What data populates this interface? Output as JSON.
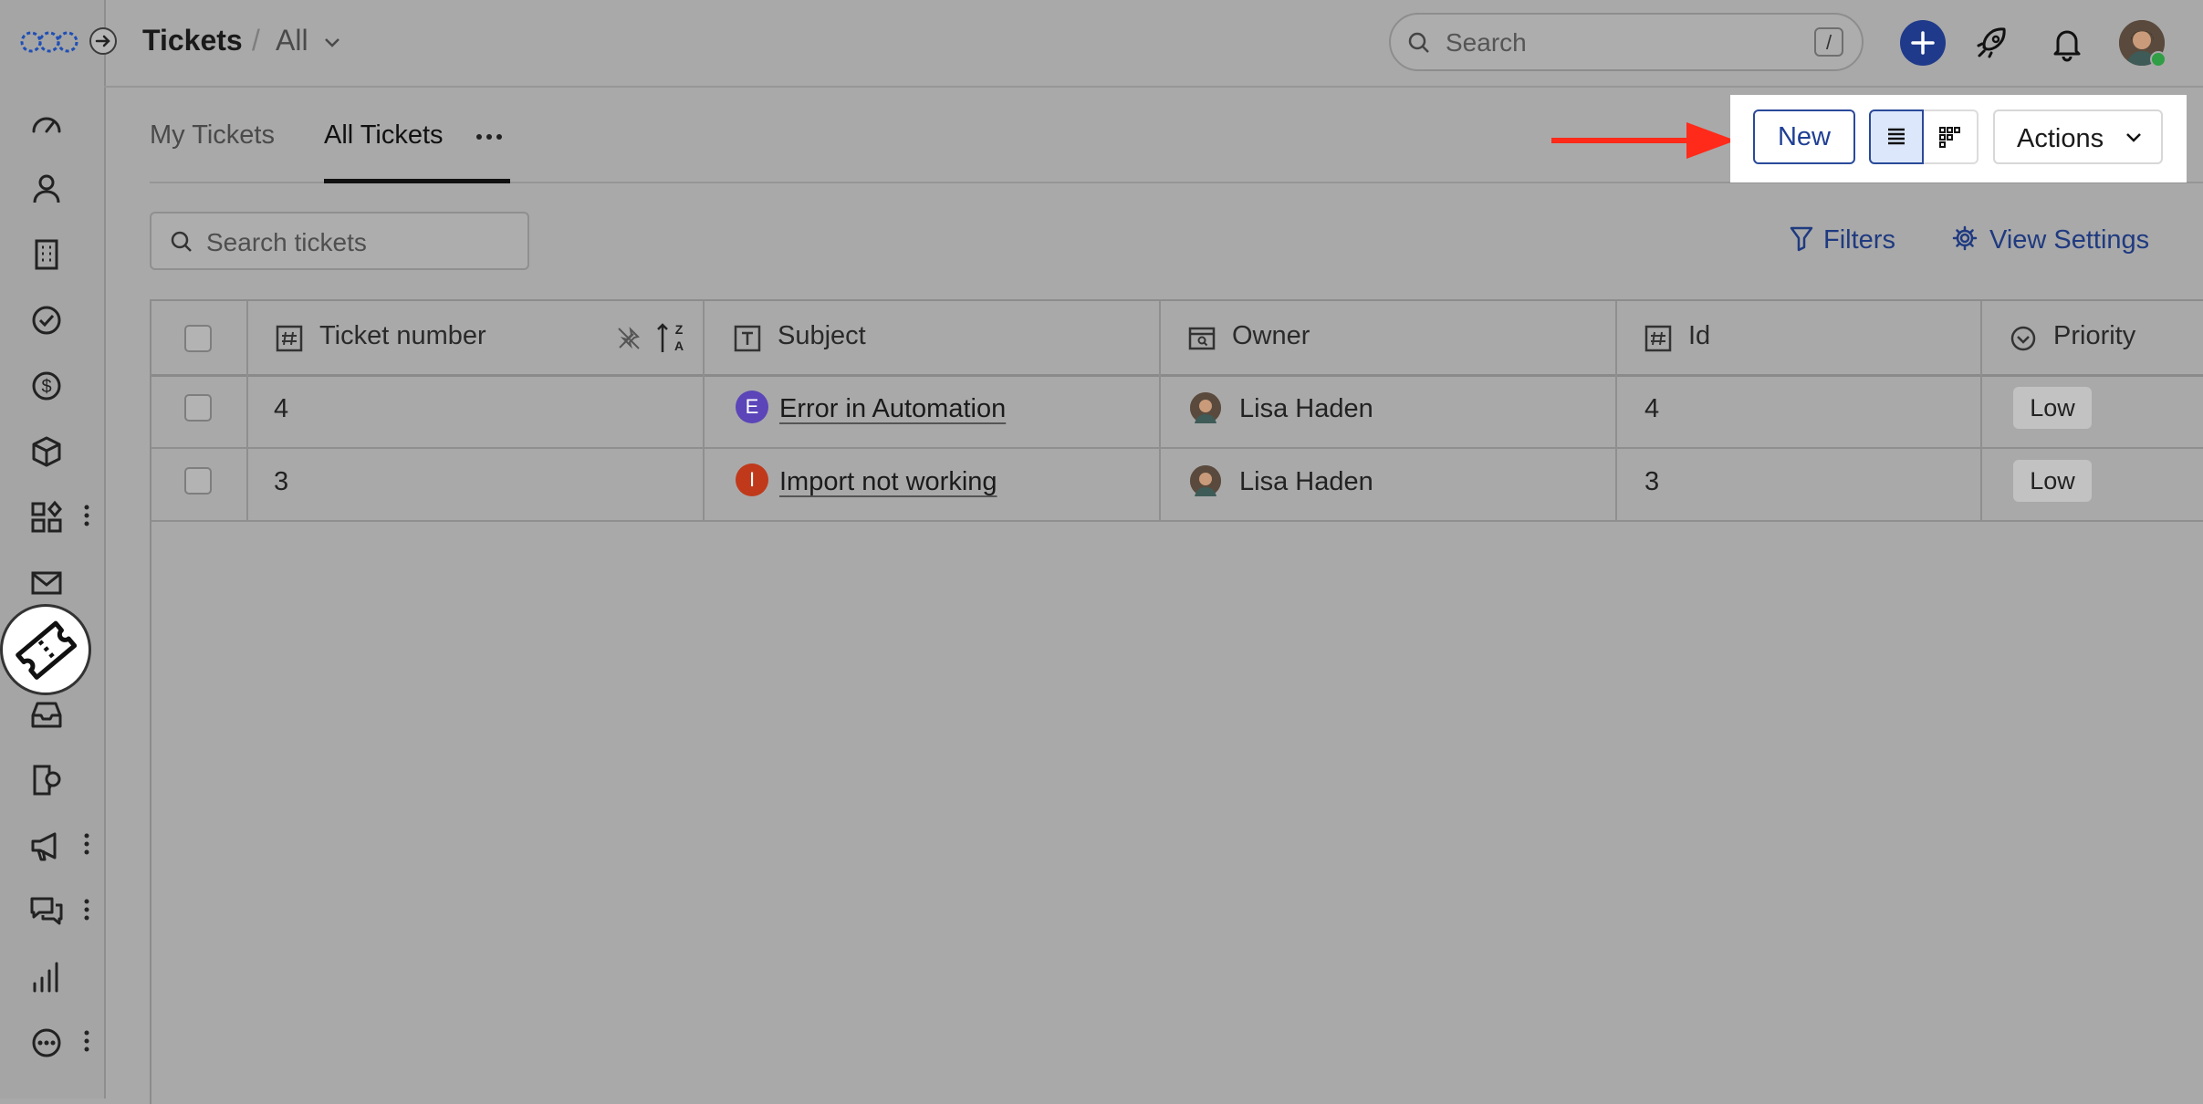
{
  "header": {
    "title": "Tickets",
    "separator": "/",
    "view": "All",
    "search_placeholder": "Search",
    "search_shortcut": "/"
  },
  "tabs": [
    {
      "label": "My Tickets",
      "active": false
    },
    {
      "label": "All Tickets",
      "active": true
    }
  ],
  "toolbar": {
    "new_label": "New",
    "actions_label": "Actions",
    "search_placeholder": "Search tickets",
    "filters_label": "Filters",
    "view_settings_label": "View Settings"
  },
  "table": {
    "columns": [
      "Ticket number",
      "Subject",
      "Owner",
      "Id",
      "Priority"
    ],
    "rows": [
      {
        "ticket_number": "4",
        "subject_initial": "E",
        "subject": "Error in Automation",
        "owner": "Lisa Haden",
        "id": "4",
        "priority": "Low"
      },
      {
        "ticket_number": "3",
        "subject_initial": "I",
        "subject": "Import not working",
        "owner": "Lisa Haden",
        "id": "3",
        "priority": "Low"
      }
    ]
  },
  "colors": {
    "accent": "#1f3a8a",
    "badge_e": "#5b45b8",
    "badge_i": "#c0391b",
    "annotation_arrow": "#ff2a1a"
  },
  "icons": [
    "dashboard-icon",
    "contacts-icon",
    "companies-icon",
    "tasks-icon",
    "deals-icon",
    "products-icon",
    "apps-icon",
    "email-icon",
    "tickets-icon",
    "inbox-icon",
    "helpdesk-icon",
    "campaigns-icon",
    "conversations-icon",
    "reports-icon",
    "more-icon"
  ]
}
